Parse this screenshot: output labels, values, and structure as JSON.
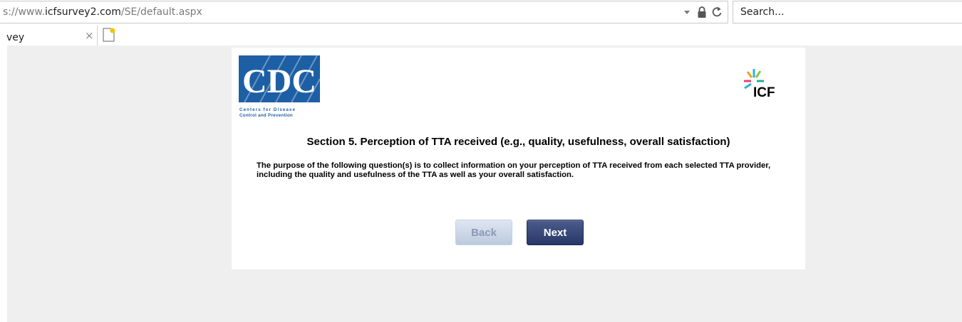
{
  "browser": {
    "url_prefix": "s://www.",
    "url_domain": "icfsurvey2.com",
    "url_path": "/SE/default.aspx",
    "search_placeholder": "Search...",
    "tab_title": "vey",
    "tab_close": "×"
  },
  "page": {
    "cdc_logo": {
      "text": "CDC",
      "line1": "Centers for Disease",
      "line2": "Control and Prevention",
      "color": "#1d5fa5"
    },
    "icf_logo": {
      "text": "ICF"
    },
    "section_title": "Section 5. Perception of TTA received (e.g., quality, usefulness, overall satisfaction)",
    "intro_text": "The purpose of the following question(s) is to collect information on your perception of TTA received from each selected TTA provider, including the quality and usefulness of the TTA as well as your overall satisfaction.",
    "back_label": "Back",
    "next_label": "Next"
  }
}
